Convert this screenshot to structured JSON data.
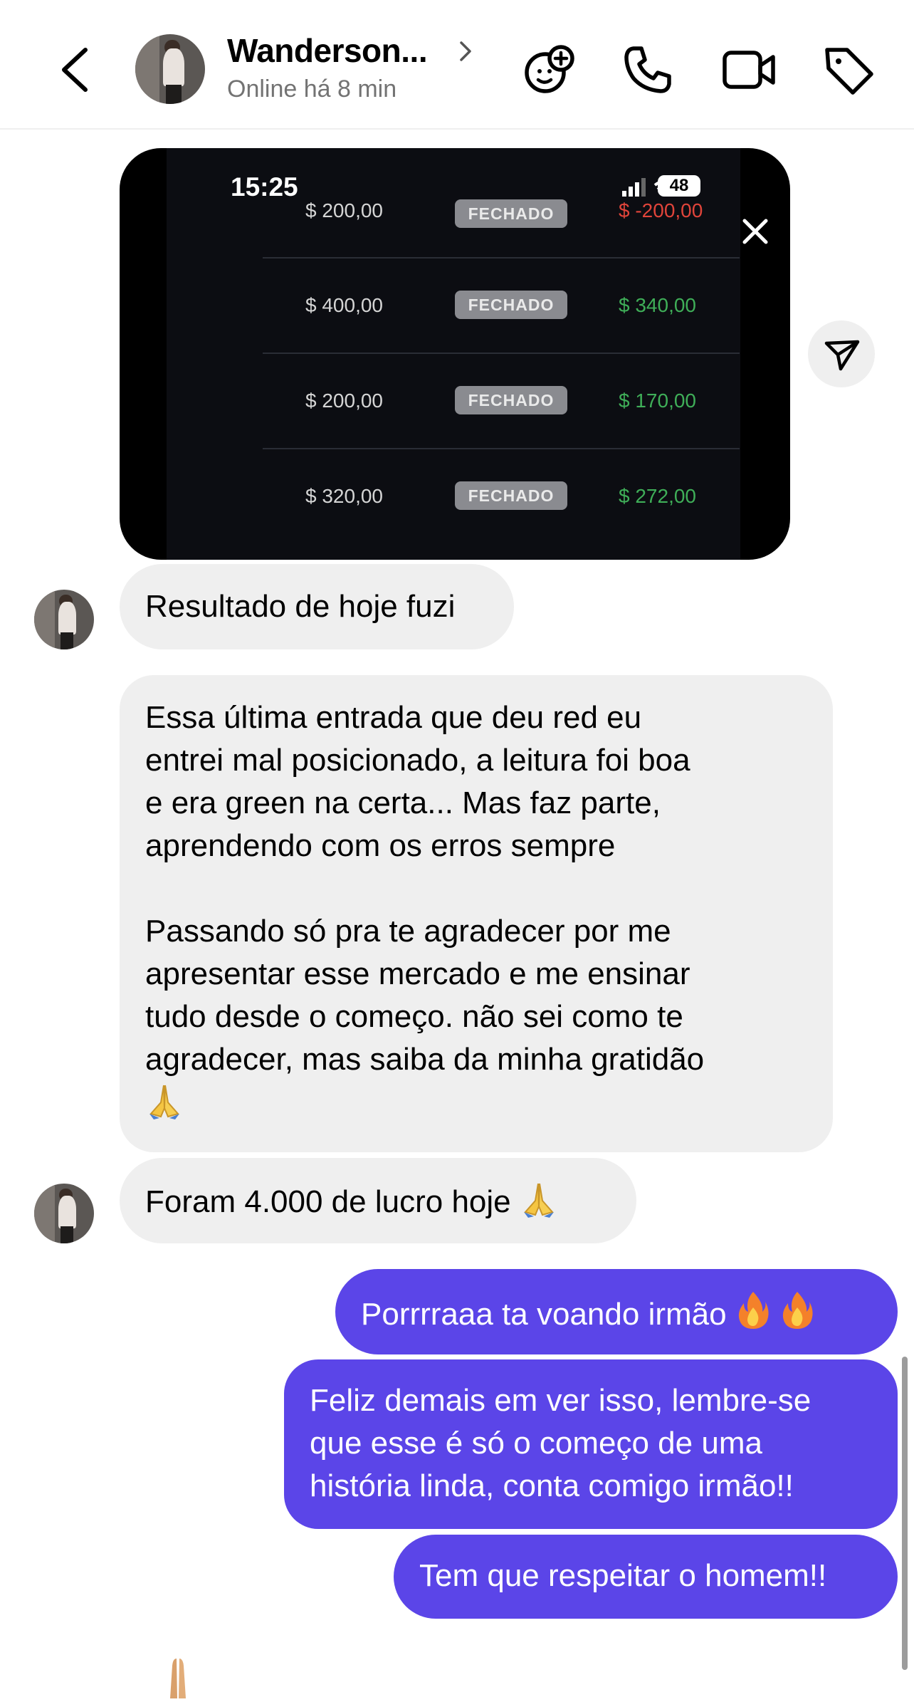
{
  "header": {
    "contact_name": "Wanderson...",
    "status": "Online há 8 min",
    "icons": [
      "back-chevron-icon",
      "chevron-right-icon",
      "effects-icon",
      "phone-icon",
      "video-camera-icon",
      "tag-icon"
    ]
  },
  "image_message": {
    "time": "15:25",
    "battery": "48",
    "trades": [
      {
        "amount": "$ 200,00",
        "status": "FECHADO",
        "result": "$ -200,00",
        "result_color": "#e0443a"
      },
      {
        "amount": "$ 400,00",
        "status": "FECHADO",
        "result": "$ 340,00",
        "result_color": "#3fae58"
      },
      {
        "amount": "$ 200,00",
        "status": "FECHADO",
        "result": "$ 170,00",
        "result_color": "#3fae58"
      },
      {
        "amount": "$ 320,00",
        "status": "FECHADO",
        "result": "$ 272,00",
        "result_color": "#3fae58"
      }
    ]
  },
  "messages": {
    "in_1": "Resultado de hoje fuzi",
    "in_2_p1": "Essa última entrada que deu red eu\nentrei mal posicionado, a leitura foi boa\ne era green na certa... Mas faz parte,\naprendendo com os erros sempre",
    "in_2_p2": "Passando só pra te agradecer por me\napresentar esse mercado e me ensinar\ntudo desde o começo. não sei como te\nagradecer, mas saiba da minha gratidão",
    "in_3": "Foram 4.000 de lucro hoje",
    "out_1": "Porrrraaa ta voando irmão",
    "out_2": "Feliz demais em ver isso, lembre-se\nque esse é só o começo de uma\nhistória linda, conta comigo irmão!!",
    "out_3": "Tem que respeitar o homem!!"
  },
  "colors": {
    "outgoing_bubble": "#5b45e8",
    "incoming_bubble": "#efefef",
    "status_text": "#737373"
  }
}
